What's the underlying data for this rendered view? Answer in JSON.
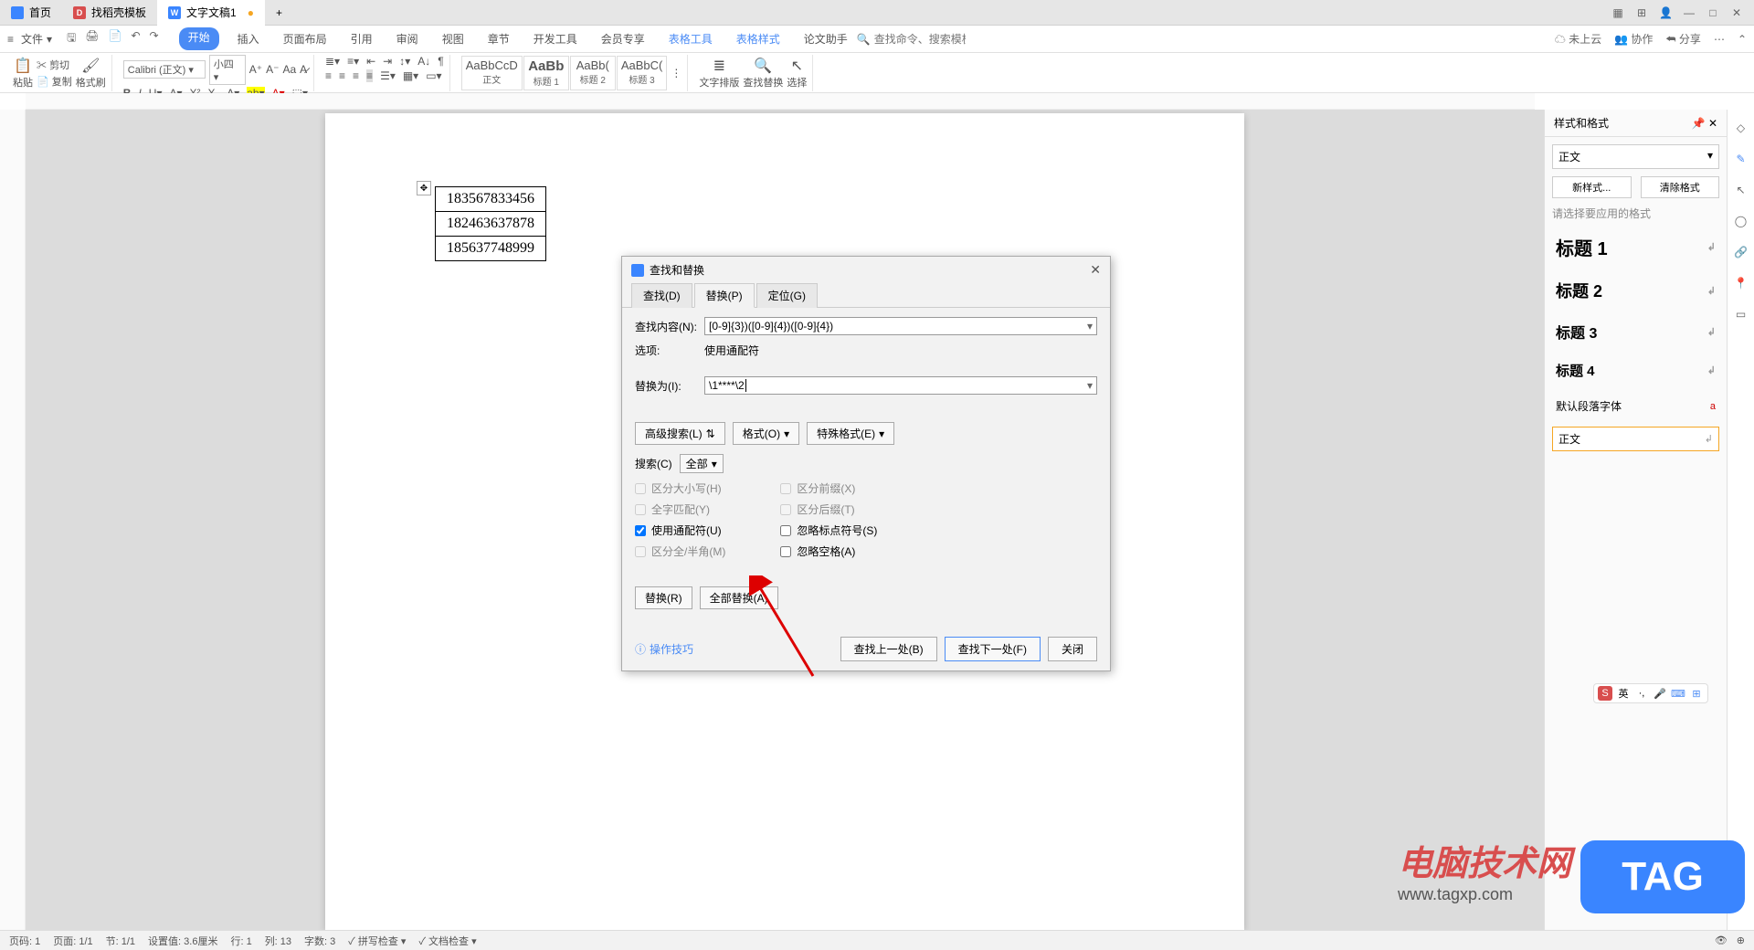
{
  "titlebar": {
    "tabs": [
      {
        "label": "首页"
      },
      {
        "label": "找稻壳模板"
      },
      {
        "label": "文字文稿1"
      }
    ]
  },
  "menubar": {
    "file": "文件",
    "tabs": [
      "开始",
      "插入",
      "页面布局",
      "引用",
      "审阅",
      "视图",
      "章节",
      "开发工具",
      "会员专享",
      "表格工具",
      "表格样式",
      "论文助手"
    ],
    "search_placeholder": "查找命令、搜索模板",
    "cloud": "未上云",
    "coop": "协作",
    "share": "分享"
  },
  "ribbon": {
    "paste": "粘贴",
    "cut": "剪切",
    "copy": "复制",
    "formatpainter": "格式刷",
    "fontname": "Calibri (正文)",
    "fontsize": "小四",
    "styles": [
      {
        "preview": "AaBbCcD",
        "label": "正文"
      },
      {
        "preview": "AaBb",
        "label": "标题 1"
      },
      {
        "preview": "AaBb(",
        "label": "标题 2"
      },
      {
        "preview": "AaBbC(",
        "label": "标题 3"
      }
    ],
    "textlayout": "文字排版",
    "findreplace": "查找替换",
    "select": "选择"
  },
  "document": {
    "rows": [
      "183567833456",
      "182463637878",
      "185637748999"
    ]
  },
  "dialog": {
    "title": "查找和替换",
    "tabs": [
      "查找(D)",
      "替换(P)",
      "定位(G)"
    ],
    "find_label": "查找内容(N):",
    "find_value": "[0-9]{3})([0-9]{4})([0-9]{4})",
    "options_label": "选项:",
    "options_value": "使用通配符",
    "replace_label": "替换为(I):",
    "replace_value": "\\1****\\2",
    "adv_search": "高级搜索(L)",
    "format_btn": "格式(O)",
    "special_btn": "特殊格式(E)",
    "search_label": "搜索(C)",
    "search_scope": "全部",
    "checks_left": [
      "区分大小写(H)",
      "全字匹配(Y)",
      "使用通配符(U)",
      "区分全/半角(M)"
    ],
    "checks_right": [
      "区分前缀(X)",
      "区分后缀(T)",
      "忽略标点符号(S)",
      "忽略空格(A)"
    ],
    "replace_btn": "替换(R)",
    "replace_all_btn": "全部替换(A)",
    "tips": "操作技巧",
    "find_prev": "查找上一处(B)",
    "find_next": "查找下一处(F)",
    "close": "关闭"
  },
  "rightpanel": {
    "title": "样式和格式",
    "current": "正文",
    "new_style": "新样式...",
    "clear_fmt": "清除格式",
    "apply_hint": "请选择要应用的格式",
    "styles": [
      "标题 1",
      "标题 2",
      "标题 3",
      "标题 4",
      "默认段落字体",
      "正文"
    ]
  },
  "statusbar": {
    "page": "页码: 1",
    "pages": "页面: 1/1",
    "section": "节: 1/1",
    "pos": "设置值: 3.6厘米",
    "line": "行: 1",
    "col": "列: 13",
    "wc": "字数: 3",
    "spell": "拼写检查",
    "doccheck": "文档检查"
  },
  "watermark": {
    "text1": "电脑技术网",
    "url": "www.tagxp.com",
    "tag": "TAG"
  },
  "ime": {
    "lang": "英"
  }
}
